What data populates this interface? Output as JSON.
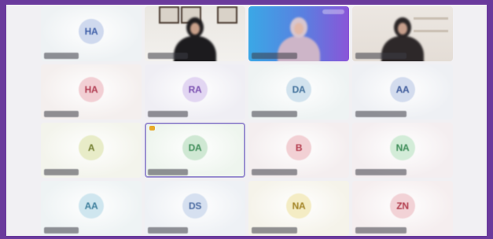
{
  "accent_color": "#6a3a9c",
  "active_tile_outline": "#9a8fd0",
  "participants": [
    {
      "initials": "HA",
      "type": "avatar",
      "bg": "#eef2f4",
      "circle": "#cfd9ee",
      "color": "#3f5fa8"
    },
    {
      "initials": "",
      "type": "video",
      "scene": "room-frames"
    },
    {
      "initials": "",
      "type": "video",
      "scene": "blue-backdrop"
    },
    {
      "initials": "",
      "type": "video",
      "scene": "room-shelf"
    },
    {
      "initials": "HA",
      "type": "avatar",
      "bg": "#f4efee",
      "circle": "#f2cfd4",
      "color": "#b03a50"
    },
    {
      "initials": "RA",
      "type": "avatar",
      "bg": "#efeef4",
      "circle": "#e2d6f2",
      "color": "#7a4fb0"
    },
    {
      "initials": "DA",
      "type": "avatar",
      "bg": "#eef3f3",
      "circle": "#d2e3ee",
      "color": "#3f6f9a"
    },
    {
      "initials": "AA",
      "type": "avatar",
      "bg": "#eef0f4",
      "circle": "#d3dcee",
      "color": "#3d5a9a"
    },
    {
      "initials": "A",
      "type": "avatar",
      "bg": "#f3f4ec",
      "circle": "#e8ecc8",
      "color": "#6e7a2a"
    },
    {
      "initials": "DA",
      "type": "avatar",
      "bg": "#eef5ee",
      "circle": "#cfe8d3",
      "color": "#3a8a55",
      "active": true,
      "hand_raised": true
    },
    {
      "initials": "B",
      "type": "avatar",
      "bg": "#f4eeef",
      "circle": "#f2d0d4",
      "color": "#b2384a"
    },
    {
      "initials": "NA",
      "type": "avatar",
      "bg": "#f4eef0",
      "circle": "#d3ecd8",
      "color": "#3a8a55"
    },
    {
      "initials": "AA",
      "type": "avatar",
      "bg": "#eef3f4",
      "circle": "#cfe6ef",
      "color": "#3a7c9a"
    },
    {
      "initials": "DS",
      "type": "avatar",
      "bg": "#eef1f5",
      "circle": "#d6e0f0",
      "color": "#4a6aa0"
    },
    {
      "initials": "NA",
      "type": "avatar",
      "bg": "#f5f3ea",
      "circle": "#f4ecc4",
      "color": "#a08020"
    },
    {
      "initials": "ZN",
      "type": "avatar",
      "bg": "#f5eeef",
      "circle": "#f2d2d6",
      "color": "#b03a4a"
    }
  ]
}
